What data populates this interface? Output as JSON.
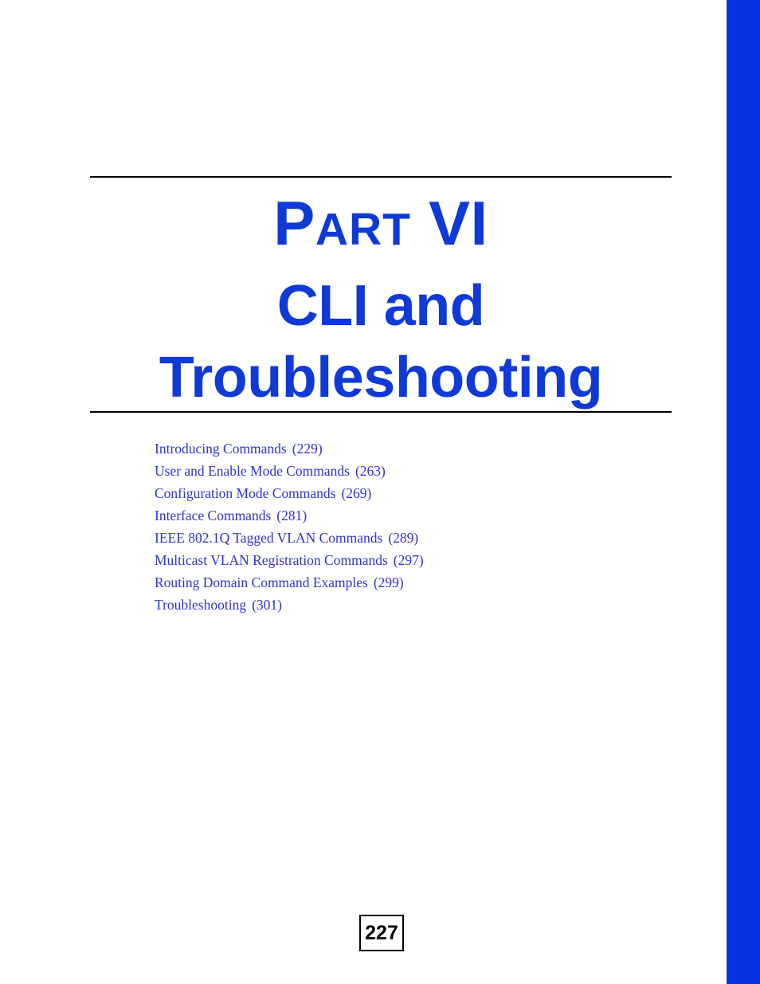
{
  "document": {
    "part_label_cap": "P",
    "part_label_rest": "ART",
    "part_number": "VI",
    "title_line_1": "CLI and",
    "title_line_2": "Troubleshooting",
    "accent_color": "#0f3ad6",
    "edge_band_color": "#0433e0",
    "link_color": "#3033cc"
  },
  "contents": [
    {
      "label": "Introducing Commands",
      "page": "(229)"
    },
    {
      "label": "User and Enable Mode Commands",
      "page": "(263)"
    },
    {
      "label": "Configuration Mode Commands",
      "page": "(269)"
    },
    {
      "label": "Interface Commands",
      "page": "(281)"
    },
    {
      "label": "IEEE 802.1Q Tagged VLAN Commands",
      "page": "(289)"
    },
    {
      "label": "Multicast VLAN Registration Commands",
      "page": "(297)"
    },
    {
      "label": "Routing Domain Command Examples",
      "page": "(299)"
    },
    {
      "label": "Troubleshooting",
      "page": "(301)"
    }
  ],
  "folio": {
    "page_number": "227"
  }
}
